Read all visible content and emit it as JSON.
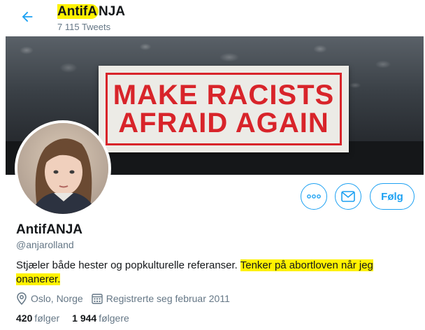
{
  "header": {
    "name_highlighted": "AntifA",
    "name_rest": "NJA",
    "tweet_count": "7 115 Tweets",
    "back_icon": "arrow-left-icon"
  },
  "banner": {
    "sticker_line1": "MAKE RACISTS",
    "sticker_line2": "AFRAID AGAIN"
  },
  "actions": {
    "more_icon": "more-icon",
    "message_icon": "envelope-icon",
    "follow_label": "Følg"
  },
  "profile": {
    "display_name": "AntifANJA",
    "handle": "@anjarolland",
    "bio_plain": "Stjæler både hester og popkulturelle referanser. ",
    "bio_highlight_1": "Tenker på abortloven når jeg",
    "bio_highlight_2": "onanerer.",
    "location": "Oslo, Norge",
    "joined": "Registrerte seg februar 2011",
    "following_count": "420",
    "following_label": "følger",
    "followers_count": "1 944",
    "followers_label": "følgere"
  },
  "colors": {
    "accent": "#1da1f2",
    "highlight": "#fff200",
    "sticker_red": "#d8242a"
  }
}
